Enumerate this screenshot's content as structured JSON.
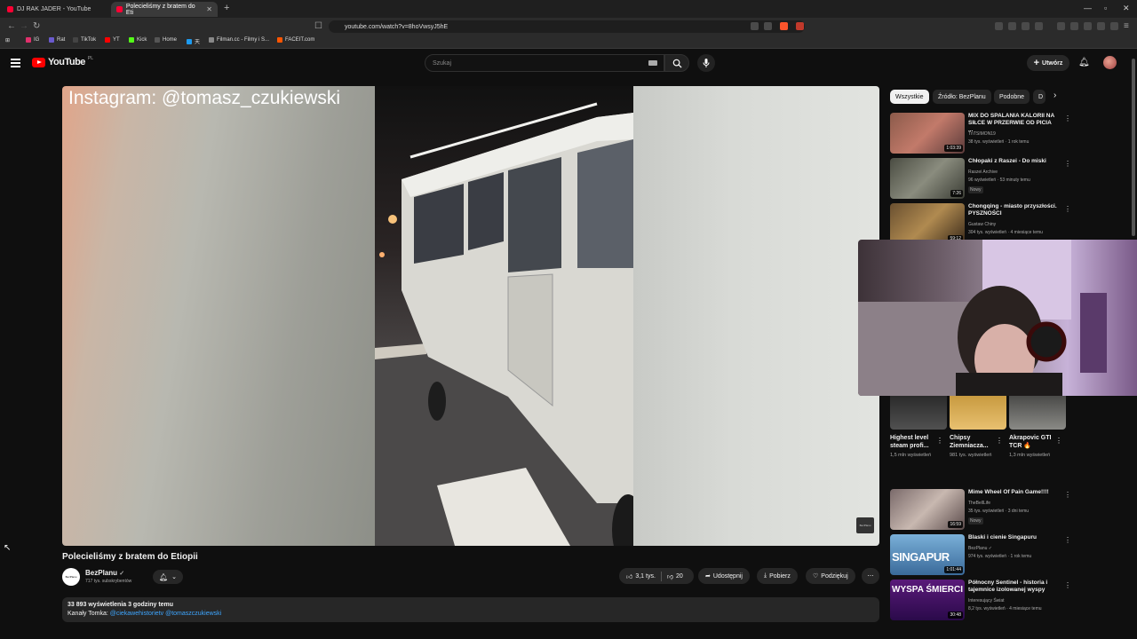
{
  "browser": {
    "tabs": [
      {
        "label": "DJ RAK JADER - YouTube",
        "active": false
      },
      {
        "label": "Polecieliśmy z bratem do Eti",
        "active": true
      }
    ],
    "new_tab": "+",
    "url": "youtube.com/watch?v=8hoVwsyJ5hE",
    "bookmarks": [
      {
        "label": "IG",
        "color": "#e1306c"
      },
      {
        "label": "Rat",
        "color": "#6a5acd"
      },
      {
        "label": "TikTok",
        "color": "#222222"
      },
      {
        "label": "YT",
        "color": "#ff0000"
      },
      {
        "label": "Kick",
        "color": "#53fc18"
      },
      {
        "label": "Home",
        "color": "#111111"
      },
      {
        "label": "天",
        "color": "#1d9bf0"
      },
      {
        "label": "Filman.cc - Filmy i S...",
        "color": "#888888"
      },
      {
        "label": "FACEIT.com",
        "color": "#ff5500"
      }
    ]
  },
  "header": {
    "logo_text": "YouTube",
    "logo_country": "PL",
    "search_placeholder": "Szukaj",
    "create_label": "Utwórz"
  },
  "player": {
    "overlay_text": "Instagram: @tomasz_czukiewski",
    "watermark": "BezPlanu"
  },
  "video": {
    "title": "Polecieliśmy z bratem do Etiopii",
    "channel_name": "BezPlanu",
    "channel_avatar_text": "BezPlanu",
    "subscribers": "717 tys. subskrybentów",
    "likes": "3,1 tys.",
    "dislikes": "20",
    "share_label": "Udostępnij",
    "download_label": "Pobierz",
    "thanks_label": "Podziękuj",
    "description_stats": "33 893 wyświetlenia  3 godziny temu",
    "description_prefix": "Kanały Tomka: ",
    "description_links": "@ciekawehistorietv @tomaszczukiewski"
  },
  "sidebar": {
    "chips": [
      "Wszystkie",
      "Źródło: BezPlanu",
      "Podobne",
      "D"
    ],
    "items": [
      {
        "title": "MIX DO SPALANIA KALORII NA SIŁCE W PRZERWIE OD PICIA ...",
        "channel": "TnTSIMON19",
        "meta": "38 tys. wyświetleń · 1 rok temu",
        "duration": "1:03:39"
      },
      {
        "title": "Chłopaki z Raszei - Do miski",
        "channel": "Raszei Archive",
        "meta": "96 wyświetleń · 53 minuty temu",
        "badge": "Nowy",
        "duration": "7:26"
      },
      {
        "title": "Chongqing - miasto przyszłości. PYSZNOŚCI",
        "channel": "Gustaw Chiny",
        "meta": "304 tys. wyświetleń · 4 miesiące temu",
        "duration": "59:12"
      },
      {
        "title": "Mime Wheel Of Pain Game!!!!",
        "channel": "TheBellLife",
        "meta": "35 tys. wyświetleń · 3 dni temu",
        "badge": "Nowy",
        "duration": "16:59"
      },
      {
        "title": "Blaski i cienie Singapuru",
        "channel": "BezPlanu ✓",
        "meta": "974 tys. wyświetleń · 1 rok temu",
        "duration": "1:01:44"
      },
      {
        "title": "Północny Sentinel - historia i tajemnice izolowanej wyspy",
        "channel": "Interesujący Świat",
        "meta": "8,2 tys. wyświetleń · 4 miesiące temu",
        "duration": "30:48"
      }
    ],
    "shorts": [
      {
        "title": "Highest level steam profi...",
        "views": "1,5 mln wyświetleń"
      },
      {
        "title": "Chipsy Ziemniacza...",
        "views": "981 tys. wyświetleń"
      },
      {
        "title": "Akrapovic GTI TCR 🔥",
        "views": "1,3 mln wyświetleń"
      }
    ],
    "thumb_texts": {
      "singapur": "SINGAPUR",
      "wyspa": "WYSPA ŚMIERCI"
    }
  }
}
